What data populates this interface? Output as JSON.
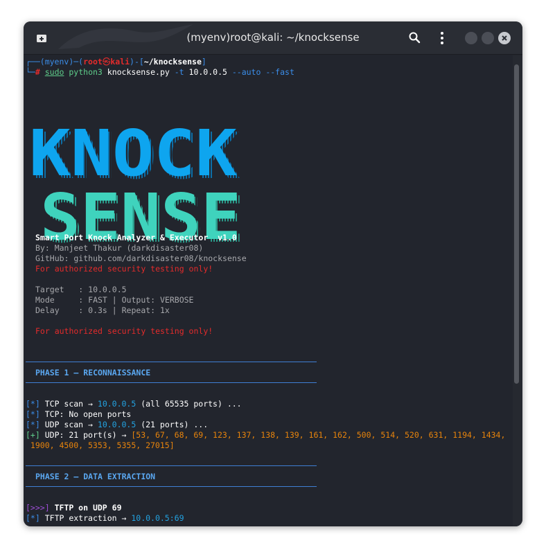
{
  "window": {
    "title": "(myenv)root@kali: ~/knocksense"
  },
  "icons": {
    "new_tab": "new-tab-icon",
    "search": "search-icon",
    "menu": "kebab-menu-icon",
    "minimize": "minimize-icon",
    "maximize": "maximize-icon",
    "close": "close-icon"
  },
  "prompt": {
    "env": "(myenv)",
    "user": "root",
    "at": "㉿",
    "host": "kali",
    "path": "~/knocksense",
    "hash": "#",
    "cmd_sudo": "sudo",
    "cmd_python": "python3",
    "cmd_script": "knocksense.py",
    "cmd_args1": "-t",
    "cmd_target": "10.0.0.5",
    "cmd_args2": "--auto --fast"
  },
  "logo": {
    "line1": "KNOCK",
    "line2": "SENSE"
  },
  "banner": {
    "subtitle": "Smart Port Knock Analyzer & Executor  v1.0",
    "author": "By: Manjeet Thakur (darkdisaster08)",
    "github": "GitHub: github.com/darkdisaster08/knocksense",
    "warning": "For authorized security testing only!"
  },
  "config": {
    "target": "Target   : 10.0.0.5",
    "mode": "Mode     : FAST | Output: VERBOSE",
    "delay": "Delay    : 0.3s | Repeat: 1x",
    "warning": "For authorized security testing only!"
  },
  "phase1": {
    "title": "PHASE 1 — RECONNAISSANCE",
    "tcp_scan_tag": "[*]",
    "tcp_scan_pre": "TCP scan → ",
    "tcp_scan_ip": "10.0.0.5",
    "tcp_scan_post": " (all 65535 ports) ...",
    "tcp_res_tag": "[*]",
    "tcp_res": "TCP: No open ports",
    "udp_scan_tag": "[*]",
    "udp_scan_pre": "UDP scan → ",
    "udp_scan_ip": "10.0.0.5",
    "udp_scan_post": " (21 ports) ...",
    "udp_res_tag": "[+]",
    "udp_res_pre": "UDP: 21 port(s) → ",
    "udp_ports_1": "[53, 67, 68, 69, 123, 137, 138, 139, 161, 162, 500, 514, 520, 631, 1194, 1434,",
    "udp_ports_2": " 1900, 4500, 5353, 5355, 27015]"
  },
  "phase2": {
    "title": "PHASE 2 — DATA EXTRACTION",
    "tftp_tag": "[>>>]",
    "tftp_label": "TFTP on UDP 69",
    "ext_tag": "[*]",
    "ext_pre": "TFTP extraction → ",
    "ext_target": "10.0.0.5:69"
  },
  "colors": {
    "terminal_bg": "#22252d",
    "titlebar_bg": "#2a2d34",
    "logo_knock": "#0ea5ef",
    "logo_sense": "#3fd3bd",
    "accent_blue": "#3b8eea",
    "warning_red": "#e52b2b",
    "ports_orange": "#e8840c"
  }
}
